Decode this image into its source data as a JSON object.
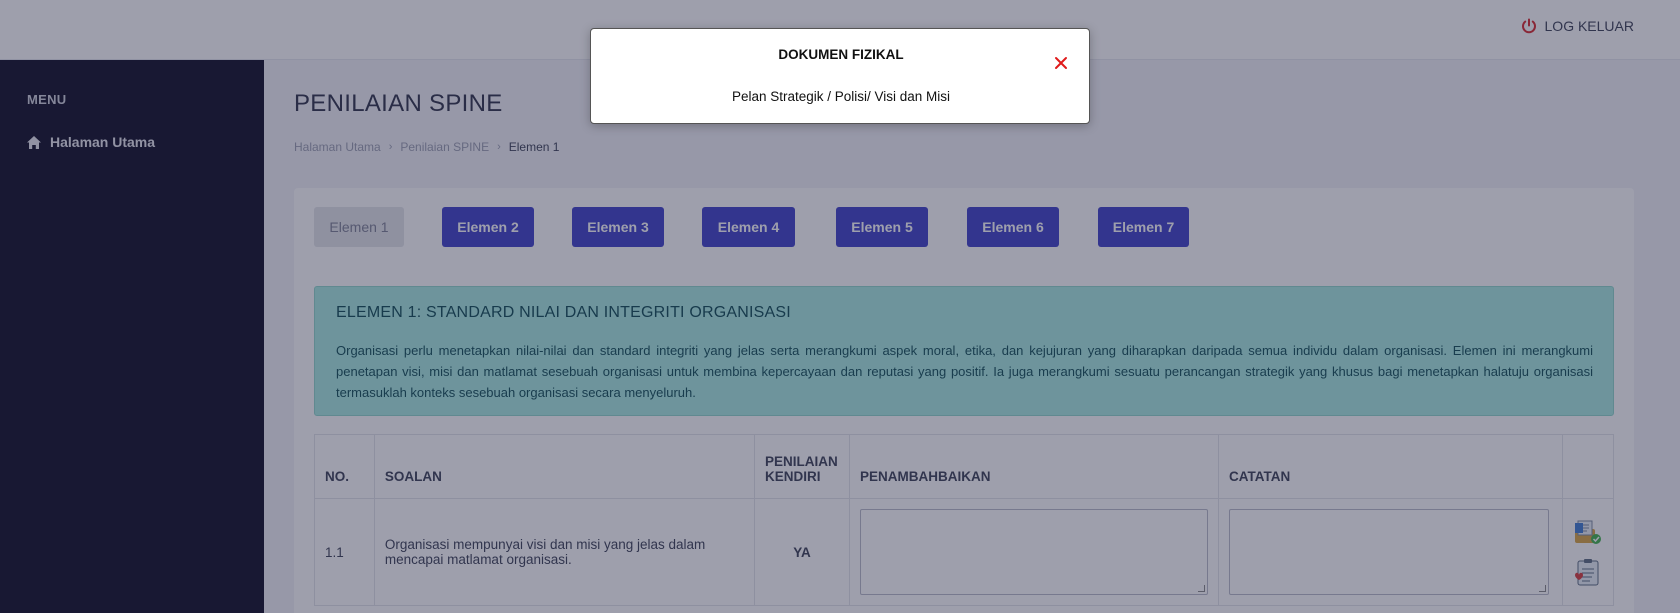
{
  "header": {
    "logout_label": "LOG KELUAR"
  },
  "sidebar": {
    "menu_title": "MENU",
    "items": [
      {
        "label": "Halaman Utama",
        "icon": "home-icon"
      }
    ]
  },
  "page": {
    "title": "PENILAIAN SPINE",
    "breadcrumb": [
      "Halaman Utama",
      "Penilaian SPINE",
      "Elemen 1"
    ]
  },
  "tabs": [
    "Elemen 1",
    "Elemen 2",
    "Elemen 3",
    "Elemen 4",
    "Elemen 5",
    "Elemen 6",
    "Elemen 7"
  ],
  "active_tab": "Elemen 1",
  "element_info": {
    "title": "ELEMEN 1: STANDARD NILAI DAN INTEGRITI ORGANISASI",
    "description": "Organisasi perlu menetapkan nilai-nilai dan standard integriti yang jelas serta merangkumi aspek moral, etika, dan kejujuran yang diharapkan daripada semua individu dalam organisasi. Elemen ini merangkumi penetapan visi, misi dan matlamat sesebuah organisasi untuk membina kepercayaan dan reputasi yang positif. Ia juga merangkumi sesuatu perancangan strategik yang khusus bagi menetapkan halatuju organisasi termasuklah konteks sesebuah organisasi secara menyeluruh."
  },
  "table": {
    "headers": {
      "no": "NO.",
      "soalan": "SOALAN",
      "penilaian_1": "PENILAIAN",
      "penilaian_2": "KENDIRI",
      "penambahbaikan": "PENAMBAHBAIKAN",
      "catatan": "CATATAN"
    },
    "rows": [
      {
        "no": "1.1",
        "soalan": "Organisasi mempunyai visi dan misi yang jelas dalam mencapai matlamat organisasi.",
        "penilaian": "YA",
        "penambahbaikan": "",
        "catatan": ""
      }
    ]
  },
  "modal": {
    "title": "DOKUMEN FIZIKAL",
    "body": "Pelan Strategik / Polisi/ Visi dan Misi"
  },
  "colors": {
    "sidebar_bg": "#0b0a23",
    "tab_bg": "#3d3fc9",
    "info_bg": "#a8ebe2",
    "close_red": "#e01b1b",
    "logout_red": "#d9262b"
  }
}
